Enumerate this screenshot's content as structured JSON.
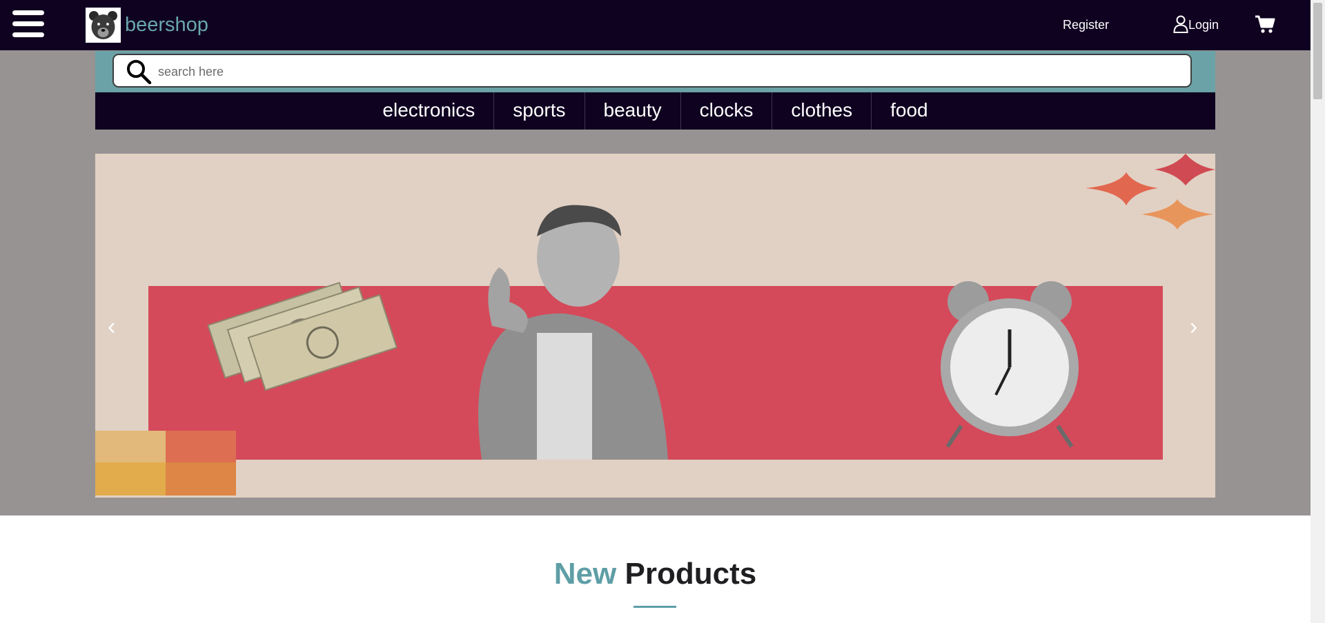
{
  "header": {
    "brand": "beershop",
    "register_label": "Register",
    "login_label": "Login",
    "menu_icon": "hamburger-menu-icon",
    "cart_icon": "cart-icon",
    "user_icon": "user-icon"
  },
  "search": {
    "placeholder": "search here"
  },
  "categories": [
    "electronics",
    "sports",
    "beauty",
    "clocks",
    "clothes",
    "food"
  ],
  "carousel": {
    "prev": "‹",
    "next": "›"
  },
  "section": {
    "title_accent": "New",
    "title_rest": "Products"
  },
  "colors": {
    "navbar": "#0f0220",
    "accent": "#6aa2a7",
    "page_gray": "#979393",
    "hero_bg": "#e1d1c4",
    "hero_band": "#d44a5a"
  }
}
